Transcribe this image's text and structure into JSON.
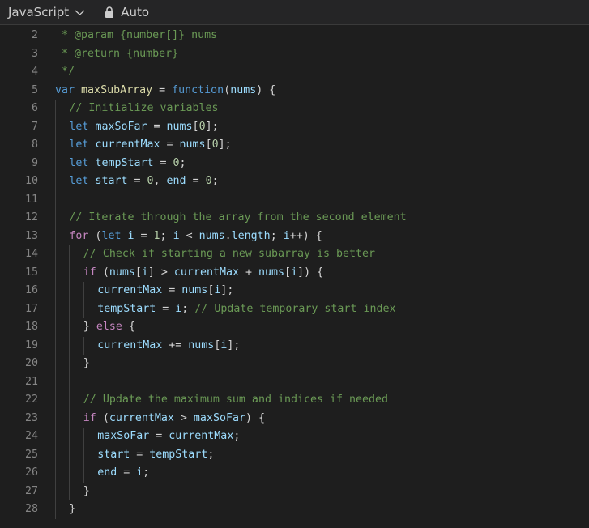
{
  "toolbar": {
    "language": "JavaScript",
    "mode": "Auto"
  },
  "editor": {
    "lines": [
      {
        "num": "2",
        "indent": 0,
        "tokens": [
          [
            "cm",
            " * @param {number[]} nums"
          ]
        ]
      },
      {
        "num": "3",
        "indent": 0,
        "tokens": [
          [
            "cm",
            " * @return {number}"
          ]
        ]
      },
      {
        "num": "4",
        "indent": 0,
        "tokens": [
          [
            "cm",
            " */"
          ]
        ]
      },
      {
        "num": "5",
        "indent": 0,
        "tokens": [
          [
            "kw",
            "var"
          ],
          [
            "pl",
            " "
          ],
          [
            "fn",
            "maxSubArray"
          ],
          [
            "pl",
            " = "
          ],
          [
            "kw",
            "function"
          ],
          [
            "pl",
            "("
          ],
          [
            "var",
            "nums"
          ],
          [
            "pl",
            ") {"
          ]
        ]
      },
      {
        "num": "6",
        "indent": 1,
        "tokens": [
          [
            "cm",
            "// Initialize variables"
          ]
        ]
      },
      {
        "num": "7",
        "indent": 1,
        "tokens": [
          [
            "kw",
            "let"
          ],
          [
            "pl",
            " "
          ],
          [
            "var",
            "maxSoFar"
          ],
          [
            "pl",
            " = "
          ],
          [
            "var",
            "nums"
          ],
          [
            "pl",
            "["
          ],
          [
            "num",
            "0"
          ],
          [
            "pl",
            "];"
          ]
        ]
      },
      {
        "num": "8",
        "indent": 1,
        "tokens": [
          [
            "kw",
            "let"
          ],
          [
            "pl",
            " "
          ],
          [
            "var",
            "currentMax"
          ],
          [
            "pl",
            " = "
          ],
          [
            "var",
            "nums"
          ],
          [
            "pl",
            "["
          ],
          [
            "num",
            "0"
          ],
          [
            "pl",
            "];"
          ]
        ]
      },
      {
        "num": "9",
        "indent": 1,
        "tokens": [
          [
            "kw",
            "let"
          ],
          [
            "pl",
            " "
          ],
          [
            "var",
            "tempStart"
          ],
          [
            "pl",
            " = "
          ],
          [
            "num",
            "0"
          ],
          [
            "pl",
            ";"
          ]
        ]
      },
      {
        "num": "10",
        "indent": 1,
        "tokens": [
          [
            "kw",
            "let"
          ],
          [
            "pl",
            " "
          ],
          [
            "var",
            "start"
          ],
          [
            "pl",
            " = "
          ],
          [
            "num",
            "0"
          ],
          [
            "pl",
            ", "
          ],
          [
            "var",
            "end"
          ],
          [
            "pl",
            " = "
          ],
          [
            "num",
            "0"
          ],
          [
            "pl",
            ";"
          ]
        ]
      },
      {
        "num": "11",
        "indent": 1,
        "tokens": []
      },
      {
        "num": "12",
        "indent": 1,
        "tokens": [
          [
            "cm",
            "// Iterate through the array from the second element"
          ]
        ]
      },
      {
        "num": "13",
        "indent": 1,
        "tokens": [
          [
            "ctrl",
            "for"
          ],
          [
            "pl",
            " ("
          ],
          [
            "kw",
            "let"
          ],
          [
            "pl",
            " "
          ],
          [
            "var",
            "i"
          ],
          [
            "pl",
            " = "
          ],
          [
            "num",
            "1"
          ],
          [
            "pl",
            "; "
          ],
          [
            "var",
            "i"
          ],
          [
            "pl",
            " < "
          ],
          [
            "var",
            "nums"
          ],
          [
            "pl",
            "."
          ],
          [
            "var",
            "length"
          ],
          [
            "pl",
            "; "
          ],
          [
            "var",
            "i"
          ],
          [
            "pl",
            "++) {"
          ]
        ]
      },
      {
        "num": "14",
        "indent": 2,
        "tokens": [
          [
            "cm",
            "// Check if starting a new subarray is better"
          ]
        ]
      },
      {
        "num": "15",
        "indent": 2,
        "tokens": [
          [
            "ctrl",
            "if"
          ],
          [
            "pl",
            " ("
          ],
          [
            "var",
            "nums"
          ],
          [
            "pl",
            "["
          ],
          [
            "var",
            "i"
          ],
          [
            "pl",
            "] > "
          ],
          [
            "var",
            "currentMax"
          ],
          [
            "pl",
            " + "
          ],
          [
            "var",
            "nums"
          ],
          [
            "pl",
            "["
          ],
          [
            "var",
            "i"
          ],
          [
            "pl",
            "]) {"
          ]
        ]
      },
      {
        "num": "16",
        "indent": 3,
        "tokens": [
          [
            "var",
            "currentMax"
          ],
          [
            "pl",
            " = "
          ],
          [
            "var",
            "nums"
          ],
          [
            "pl",
            "["
          ],
          [
            "var",
            "i"
          ],
          [
            "pl",
            "];"
          ]
        ]
      },
      {
        "num": "17",
        "indent": 3,
        "tokens": [
          [
            "var",
            "tempStart"
          ],
          [
            "pl",
            " = "
          ],
          [
            "var",
            "i"
          ],
          [
            "pl",
            "; "
          ],
          [
            "cm",
            "// Update temporary start index"
          ]
        ]
      },
      {
        "num": "18",
        "indent": 2,
        "tokens": [
          [
            "pl",
            "} "
          ],
          [
            "ctrl",
            "else"
          ],
          [
            "pl",
            " {"
          ]
        ]
      },
      {
        "num": "19",
        "indent": 3,
        "tokens": [
          [
            "var",
            "currentMax"
          ],
          [
            "pl",
            " += "
          ],
          [
            "var",
            "nums"
          ],
          [
            "pl",
            "["
          ],
          [
            "var",
            "i"
          ],
          [
            "pl",
            "];"
          ]
        ]
      },
      {
        "num": "20",
        "indent": 2,
        "tokens": [
          [
            "pl",
            "}"
          ]
        ]
      },
      {
        "num": "21",
        "indent": 2,
        "tokens": []
      },
      {
        "num": "22",
        "indent": 2,
        "tokens": [
          [
            "cm",
            "// Update the maximum sum and indices if needed"
          ]
        ]
      },
      {
        "num": "23",
        "indent": 2,
        "tokens": [
          [
            "ctrl",
            "if"
          ],
          [
            "pl",
            " ("
          ],
          [
            "var",
            "currentMax"
          ],
          [
            "pl",
            " > "
          ],
          [
            "var",
            "maxSoFar"
          ],
          [
            "pl",
            ") {"
          ]
        ]
      },
      {
        "num": "24",
        "indent": 3,
        "tokens": [
          [
            "var",
            "maxSoFar"
          ],
          [
            "pl",
            " = "
          ],
          [
            "var",
            "currentMax"
          ],
          [
            "pl",
            ";"
          ]
        ]
      },
      {
        "num": "25",
        "indent": 3,
        "tokens": [
          [
            "var",
            "start"
          ],
          [
            "pl",
            " = "
          ],
          [
            "var",
            "tempStart"
          ],
          [
            "pl",
            ";"
          ]
        ]
      },
      {
        "num": "26",
        "indent": 3,
        "tokens": [
          [
            "var",
            "end"
          ],
          [
            "pl",
            " = "
          ],
          [
            "var",
            "i"
          ],
          [
            "pl",
            ";"
          ]
        ]
      },
      {
        "num": "27",
        "indent": 2,
        "tokens": [
          [
            "pl",
            "}"
          ]
        ]
      },
      {
        "num": "28",
        "indent": 1,
        "tokens": [
          [
            "pl",
            "}"
          ]
        ]
      }
    ]
  }
}
